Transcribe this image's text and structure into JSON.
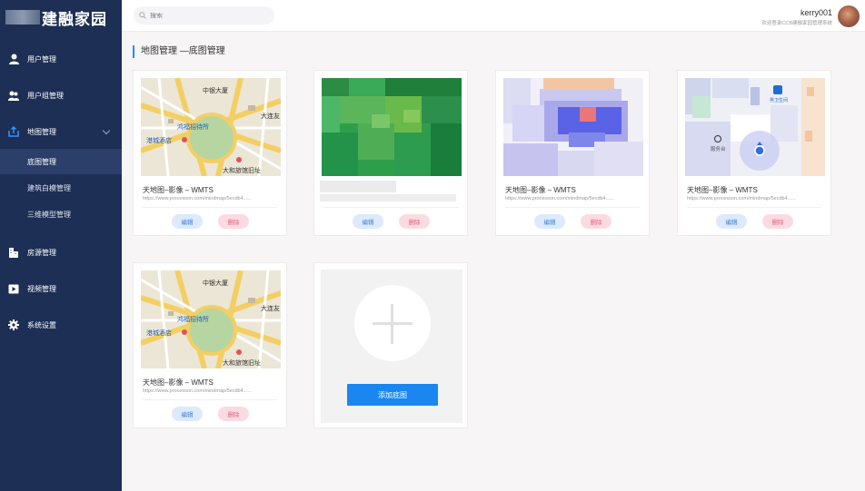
{
  "app": {
    "logo_text": "建融家园"
  },
  "sidebar": {
    "items": [
      {
        "label": "用户管理",
        "icon": "user-icon"
      },
      {
        "label": "用户组管理",
        "icon": "users-icon"
      },
      {
        "label": "地图管理",
        "icon": "map-export-icon",
        "expanded": true
      },
      {
        "label": "房源管理",
        "icon": "building-icon"
      },
      {
        "label": "视频管理",
        "icon": "video-icon"
      },
      {
        "label": "系统设置",
        "icon": "gear-icon"
      }
    ],
    "sub_items": [
      {
        "label": "底图管理",
        "active": true
      },
      {
        "label": "建筑白模管理"
      },
      {
        "label": "三维模型管理"
      }
    ]
  },
  "header": {
    "search_placeholder": "搜索",
    "user_name": "kerry001",
    "user_subtitle": "欢迎登录CCB建融家园管理系统"
  },
  "page": {
    "title": "地图管理 —底图管理"
  },
  "cards": [
    {
      "title": "天地图–影像 – WMTS",
      "url": "https://www.processon.com/mindmap/5ecdb4......",
      "edit_label": "编辑",
      "delete_label": "删除",
      "thumb": "street-map"
    },
    {
      "title": "",
      "url": "",
      "edit_label": "编辑",
      "delete_label": "删除",
      "thumb": "satellite-green"
    },
    {
      "title": "天地图–影像 – WMTS",
      "url": "https://www.processon.com/mindmap/5ecdb4......",
      "edit_label": "编辑",
      "delete_label": "删除",
      "thumb": "heatmap"
    },
    {
      "title": "天地图–影像 – WMTS",
      "url": "https://www.processon.com/mindmap/5ecdb4......",
      "edit_label": "编辑",
      "delete_label": "删除",
      "thumb": "indoor-map"
    },
    {
      "title": "天地图–影像 – WMTS",
      "url": "https://www.processon.com/mindmap/5ecdb4......",
      "edit_label": "编辑",
      "delete_label": "删除",
      "thumb": "street-map"
    }
  ],
  "add_card": {
    "button_label": "添加底图"
  },
  "map_labels": {
    "street": [
      "中银大厦",
      "鸿福招待所",
      "港城酒店",
      "大和旅馆旧址",
      "大连友"
    ],
    "indoor": [
      "服务台",
      "男卫生间"
    ]
  },
  "colors": {
    "sidebar": "#1e2f55",
    "accent": "#1890ff",
    "edit": "#3d7fd9",
    "delete": "#e4607a"
  }
}
